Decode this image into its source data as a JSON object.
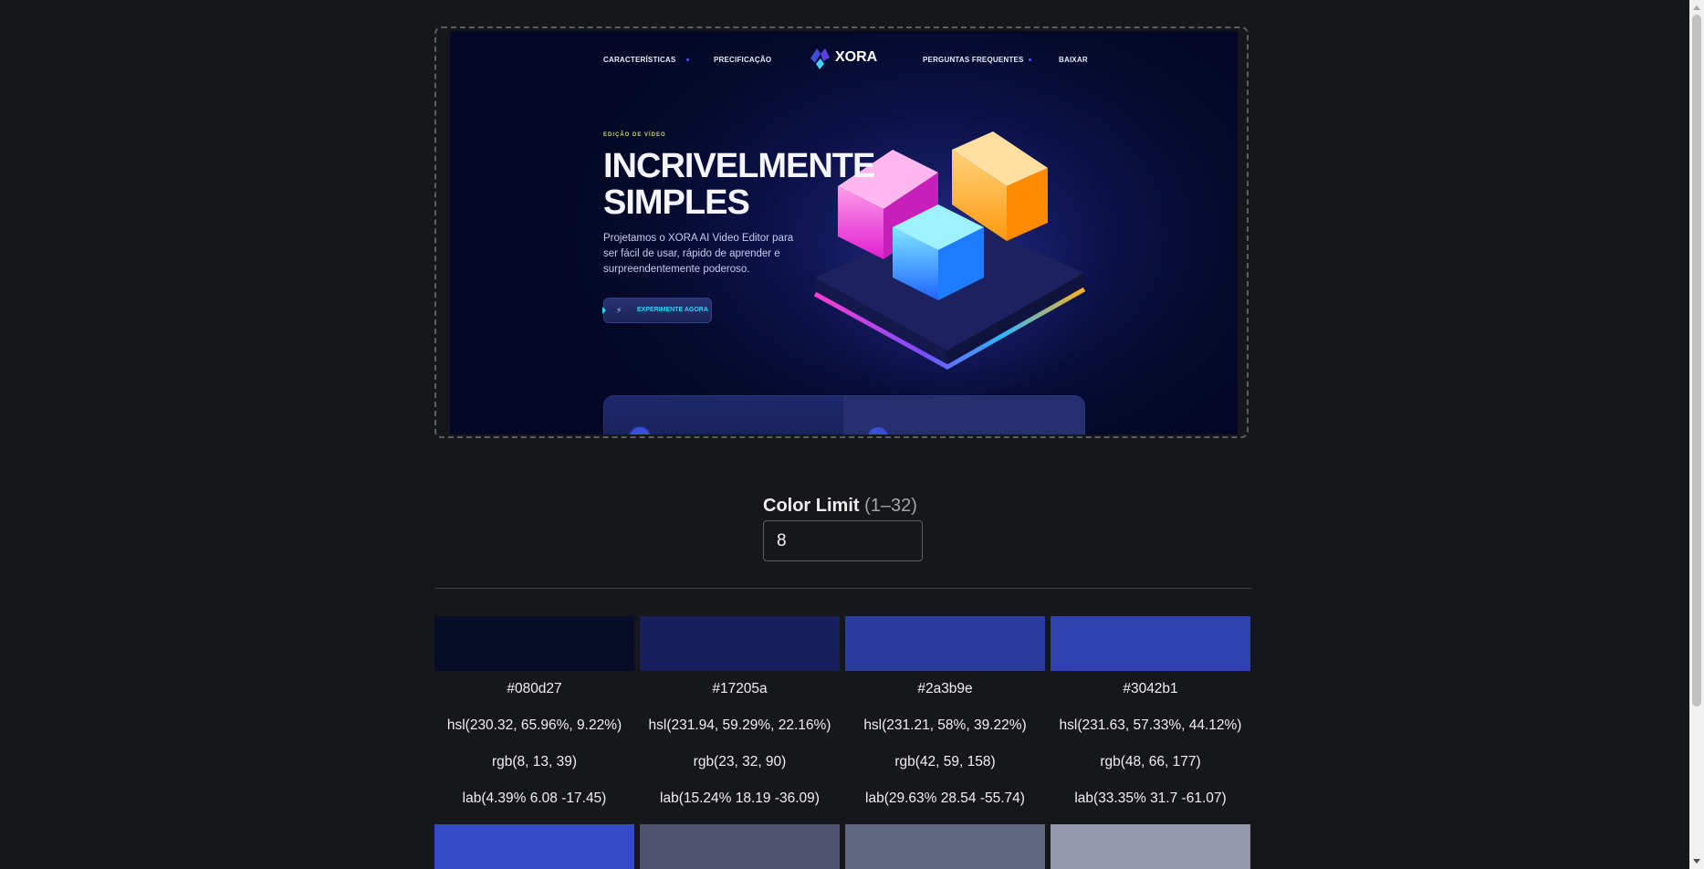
{
  "preview": {
    "nav_left": [
      "CARACTERÍSTICAS",
      "PRECIFICAÇÃO"
    ],
    "nav_right": [
      "PERGUNTAS FREQUENTES",
      "BAIXAR"
    ],
    "logo_text": "XORA",
    "eyebrow": "EDIÇÃO DE VÍDEO",
    "title_line1": "INCRIVELMENTE",
    "title_line2": "SIMPLES",
    "description": "Projetamos o XORA AI Video Editor para ser fácil de usar, rápido de aprender e surpreendentemente poderoso.",
    "cta_label": "EXPERIMENTE AGORA",
    "icon": "cube-art-image"
  },
  "controls": {
    "color_limit_label": "Color Limit",
    "color_limit_range": "(1–32)",
    "color_limit_value": "8"
  },
  "swatches": [
    {
      "color": "#080d27",
      "hex": "#080d27",
      "hsl": "hsl(230.32, 65.96%, 9.22%)",
      "rgb": "rgb(8, 13, 39)",
      "lab": "lab(4.39% 6.08 -17.45)"
    },
    {
      "color": "#17205a",
      "hex": "#17205a",
      "hsl": "hsl(231.94, 59.29%, 22.16%)",
      "rgb": "rgb(23, 32, 90)",
      "lab": "lab(15.24% 18.19 -36.09)"
    },
    {
      "color": "#2a3b9e",
      "hex": "#2a3b9e",
      "hsl": "hsl(231.21, 58%, 39.22%)",
      "rgb": "rgb(42, 59, 158)",
      "lab": "lab(29.63% 28.54 -55.74)"
    },
    {
      "color": "#3042b1",
      "hex": "#3042b1",
      "hsl": "hsl(231.63, 57.33%, 44.12%)",
      "rgb": "rgb(48, 66, 177)",
      "lab": "lab(33.35% 31.7 -61.07)"
    }
  ],
  "swatches_row2": [
    {
      "color": "#364ac8"
    },
    {
      "color": "#4e526e"
    },
    {
      "color": "#626781"
    },
    {
      "color": "#9497ab"
    }
  ]
}
